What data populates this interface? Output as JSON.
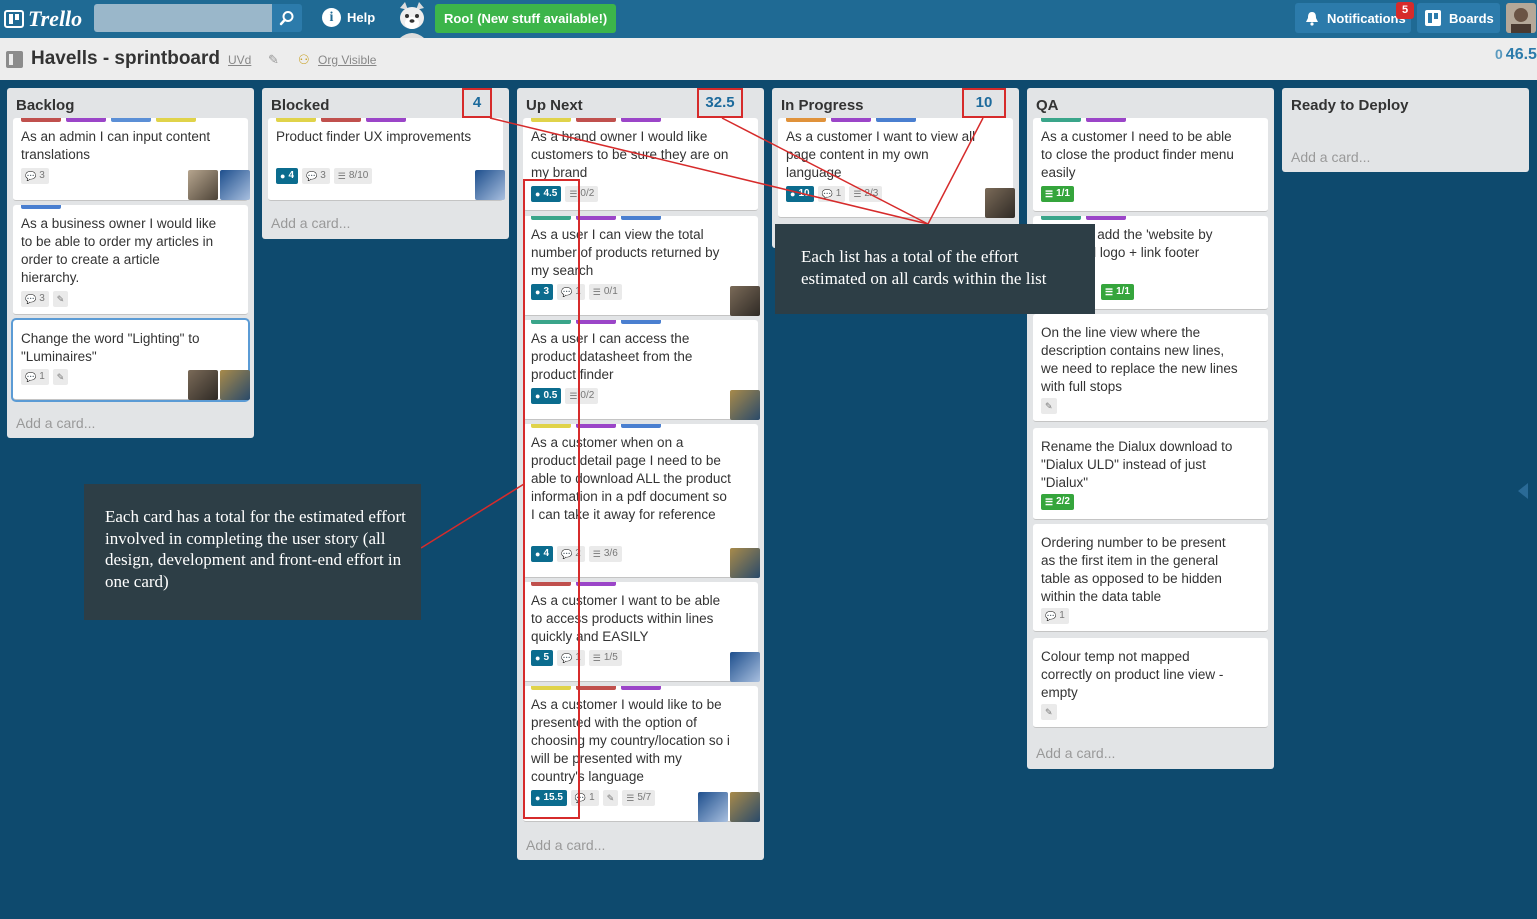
{
  "topbar": {
    "logo_text": "Trello",
    "search_placeholder": "",
    "help_label": "Help",
    "roo_banner": "Roo! (New stuff available!)",
    "notifications_label": "Notifications",
    "notifications_count": "5",
    "boards_label": "Boards"
  },
  "header": {
    "board_title": "Havells - sprintboard",
    "org_label": "UVd",
    "visibility_label": "Org Visible",
    "board_total_zero": "0",
    "board_total": "46.5"
  },
  "lists": [
    {
      "title": "Backlog",
      "add_card": "Add a card...",
      "cards": [
        {
          "title": "As an admin I can input content translations",
          "labels": [
            "#c0504d",
            "#9b45c8",
            "#5b8fd6",
            "#e0d34a"
          ],
          "comments": "3"
        },
        {
          "title": "As a business owner I would like to be able to order my articles in order to create a article hierarchy.",
          "labels": [
            "#4a7fd0"
          ],
          "comments": "3"
        },
        {
          "title": "Change the word \"Lighting\" to \"Luminaires\"",
          "labels": [],
          "comments": "1"
        }
      ]
    },
    {
      "title": "Blocked",
      "total": "4",
      "add_card": "Add a card...",
      "cards": [
        {
          "title": "Product finder UX improvements",
          "labels": [
            "#e0d34a",
            "#c0504d",
            "#9b45c8"
          ],
          "estimate": "4",
          "comments": "3",
          "checklist": "8/10"
        }
      ]
    },
    {
      "title": "Up Next",
      "total": "32.5",
      "add_card": "Add a card...",
      "cards": [
        {
          "title": "As a brand owner I would like customers to be sure they are on my brand",
          "labels": [
            "#e0d34a",
            "#c0504d",
            "#9b45c8"
          ],
          "estimate": "4.5",
          "checklist": "0/2"
        },
        {
          "title": "As a user I can view the total number of products returned by my search",
          "labels": [
            "#3aa58a",
            "#9b45c8",
            "#4a7fd0"
          ],
          "estimate": "3",
          "comments": "1",
          "checklist": "0/1"
        },
        {
          "title": "As a user I can access the product datasheet from the product finder",
          "labels": [
            "#3aa58a",
            "#9b45c8",
            "#4a7fd0"
          ],
          "estimate": "0.5",
          "checklist": "0/2"
        },
        {
          "title": "As a customer when on a product detail page I need to be able to download ALL the product information in a pdf document so I can take it away for reference",
          "labels": [
            "#e0d34a",
            "#9b45c8",
            "#4a7fd0"
          ],
          "estimate": "4",
          "comments": "2",
          "checklist": "3/6"
        },
        {
          "title": "As a customer I want to be able to access products within lines quickly and EASILY",
          "labels": [
            "#c0504d",
            "#9b45c8"
          ],
          "estimate": "5",
          "comments": "1",
          "checklist": "1/5"
        },
        {
          "title": "As a customer I would like to be presented with the option of choosing my country/location so i will be presented with my country's language",
          "labels": [
            "#e0d34a",
            "#c0504d",
            "#9b45c8"
          ],
          "estimate": "15.5",
          "comments": "1",
          "checklist": "5/7"
        }
      ]
    },
    {
      "title": "In Progress",
      "total": "10",
      "cards": [
        {
          "title": "As a customer I want to view all page content in my own language",
          "labels": [
            "#e0923a",
            "#9b45c8",
            "#4a7fd0"
          ],
          "estimate": "10",
          "comments": "1",
          "checklist": "2/3"
        }
      ]
    },
    {
      "title": "QA",
      "add_card": "Add a card...",
      "cards": [
        {
          "title": "As a customer I need to be able to close the product finder menu easily",
          "labels": [
            "#3aa58a",
            "#9b45c8"
          ],
          "checklist": "1/1"
        },
        {
          "title": "I need to add the 'website by UVd' and logo + link footer",
          "labels": [
            "#3aa58a",
            "#9b45c8"
          ],
          "checklist": "1/1"
        },
        {
          "title": "On the line view where the description contains new lines, we need to replace the new lines with full stops",
          "labels": []
        },
        {
          "title": "Rename the Dialux download to \"Dialux ULD\" instead of just \"Dialux\"",
          "labels": [],
          "checklist": "2/2"
        },
        {
          "title": "Ordering number to be present as the first item in the general table as opposed to be hidden within the data table",
          "labels": [],
          "comments": "1"
        },
        {
          "title": "Colour temp not mapped correctly on product line view - empty",
          "labels": []
        }
      ]
    },
    {
      "title": "Ready to Deploy",
      "add_card": "Add a card...",
      "cards": []
    }
  ],
  "callouts": {
    "list_total": "Each list has a total of the effort estimated on all cards within the list",
    "card_total": "Each card has a total for the estimated effort involved in completing the user story (all design, development and front-end effort in one card)"
  },
  "colors": {
    "board_bg": "#0e4a6e",
    "topbar": "#1f6a94",
    "estimate_badge": "#0b6c8e",
    "checklist_done": "#35a53c",
    "annotation_red": "#d62b2b"
  }
}
